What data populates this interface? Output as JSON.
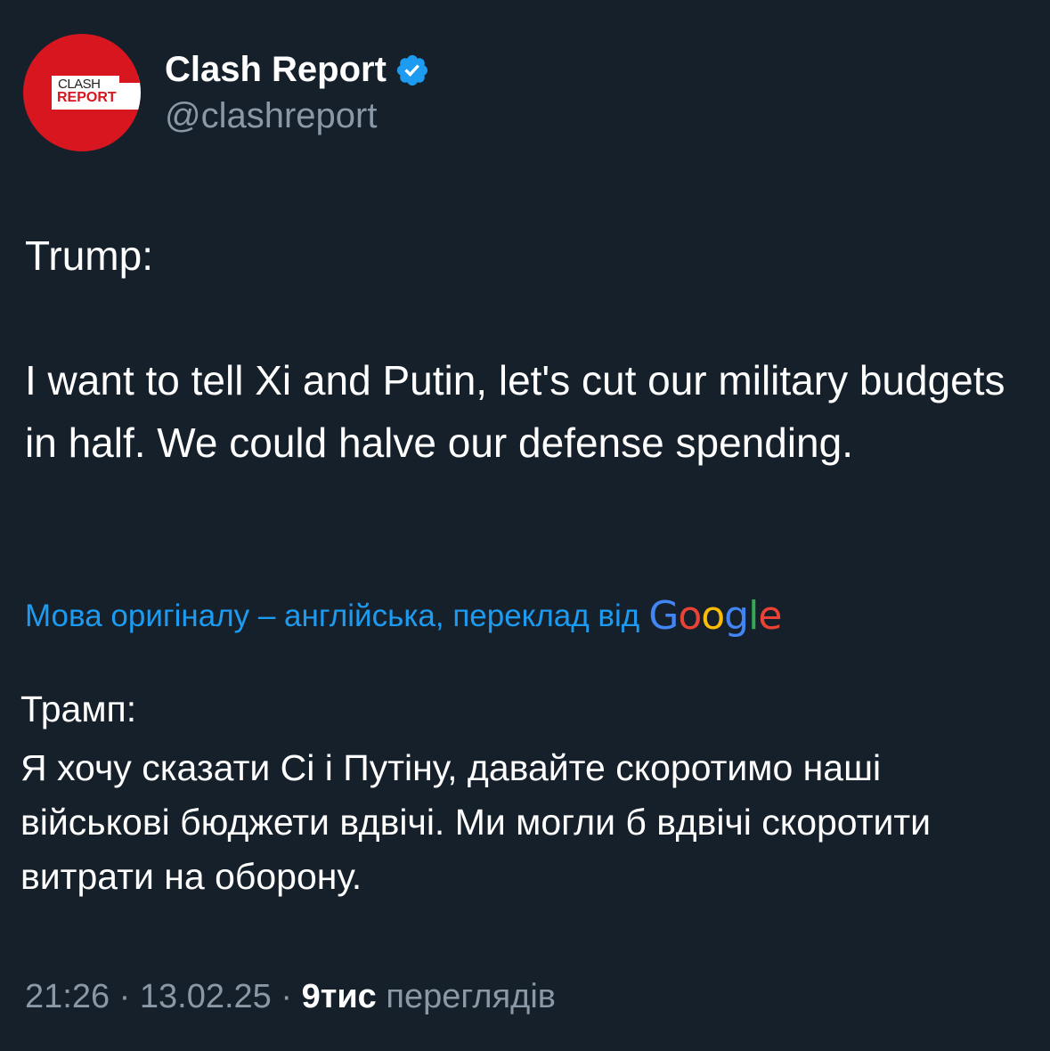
{
  "account": {
    "avatar_top": "CLASH",
    "avatar_bottom": "REPORT",
    "display_name": "Clash Report",
    "handle": "@clashreport"
  },
  "post": {
    "speaker": "Trump:",
    "quote": "I want to tell Xi and Putin, let's cut our military budgets in half. We could halve our defense spending."
  },
  "translation": {
    "notice": "Мова оригіналу – англійська, переклад від",
    "provider": "Google",
    "speaker": "Трамп:",
    "quote": "Я хочу сказати Сі і Путіну, давайте скоротимо наші військові бюджети вдвічі. Ми могли б вдвічі скоротити витрати на оборону."
  },
  "meta": {
    "time": "21:26",
    "separator": "·",
    "date": "13.02.25",
    "views_count": "9тис",
    "views_label": "переглядів"
  },
  "colors": {
    "background": "#15202b",
    "link": "#1d9bf0",
    "muted": "#8b98a5",
    "brand_red": "#d7161f",
    "verified": "#1d9bf0",
    "google_blue": "#4285f4",
    "google_red": "#ea4335",
    "google_yellow": "#fbbc05",
    "google_green": "#34a853"
  },
  "icons": {
    "verified": "verified-badge-icon"
  }
}
